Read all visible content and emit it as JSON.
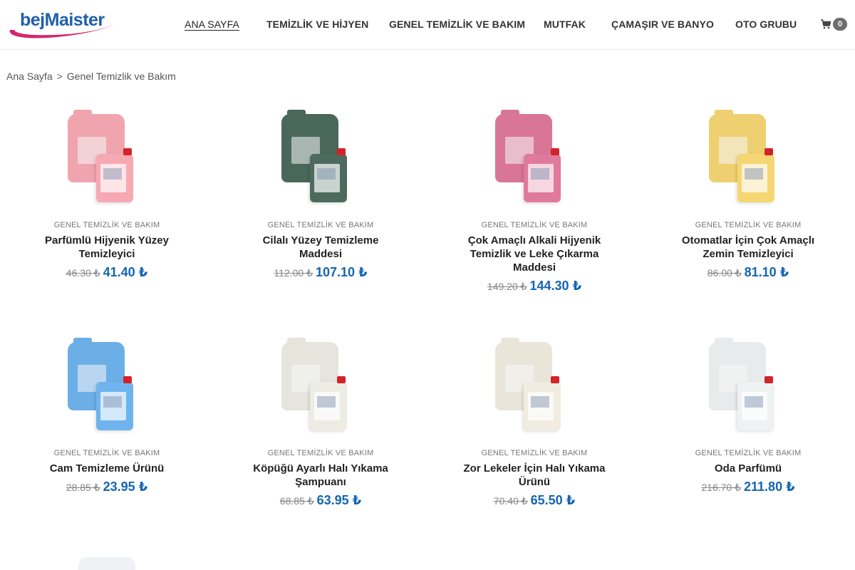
{
  "brand": {
    "logo_part1": "bej",
    "logo_part2": "Maister",
    "primary_color": "#1e5fa8",
    "swoosh_color": "#d6256e"
  },
  "nav": {
    "items": [
      {
        "label": "ANA SAYFA",
        "active": true
      },
      {
        "label": "TEMİZLİK VE HİJYEN"
      },
      {
        "label": "GENEL TEMİZLİK VE BAKIM"
      },
      {
        "label": "MUTFAK"
      },
      {
        "label": "ÇAMAŞIR VE BANYO"
      },
      {
        "label": "OTO GRUBU"
      }
    ],
    "cart_icon": "shopping-cart-icon",
    "cart_count": "0"
  },
  "breadcrumb": {
    "home": "Ana Sayfa",
    "separator": ">",
    "current": "Genel Temizlik ve Bakım"
  },
  "products": [
    {
      "category": "GENEL TEMİZLİK VE BAKIM",
      "name": "Parfümlü Hijyenik Yüzey Temizleyici",
      "old_price": "46.30 ₺",
      "price": "41.40 ₺",
      "color": "#f7a9b3"
    },
    {
      "category": "GENEL TEMİZLİK VE BAKIM",
      "name": "Cilalı Yüzey Temizleme Maddesi",
      "old_price": "112.00 ₺",
      "price": "107.10 ₺",
      "color": "#4c6a5e"
    },
    {
      "category": "GENEL TEMİZLİK VE BAKIM",
      "name": "Çok Amaçlı Alkali Hijyenik Temizlik ve Leke Çıkarma Maddesi",
      "old_price": "149.20 ₺",
      "price": "144.30 ₺",
      "color": "#e07a9c"
    },
    {
      "category": "GENEL TEMİZLİK VE BAKIM",
      "name": "Otomatlar İçin Çok Amaçlı Zemin Temizleyici",
      "old_price": "86.00 ₺",
      "price": "81.10 ₺",
      "color": "#f6d673"
    },
    {
      "category": "GENEL TEMİZLİK VE BAKIM",
      "name": "Cam Temizleme Ürünü",
      "old_price": "28.85 ₺",
      "price": "23.95 ₺",
      "color": "#6fb4ee"
    },
    {
      "category": "GENEL TEMİZLİK VE BAKIM",
      "name": "Köpüğü Ayarlı Halı Yıkama Şampuanı",
      "old_price": "68.85 ₺",
      "price": "63.95 ₺",
      "color": "#ecece4"
    },
    {
      "category": "GENEL TEMİZLİK VE BAKIM",
      "name": "Zor Lekeler İçin Halı Yıkama Ürünü",
      "old_price": "70.40 ₺",
      "price": "65.50 ₺",
      "color": "#f0ece0"
    },
    {
      "category": "GENEL TEMİZLİK VE BAKIM",
      "name": "Oda Parfümü",
      "old_price": "216.70 ₺",
      "price": "211.80 ₺",
      "color": "#eef2f2"
    }
  ]
}
